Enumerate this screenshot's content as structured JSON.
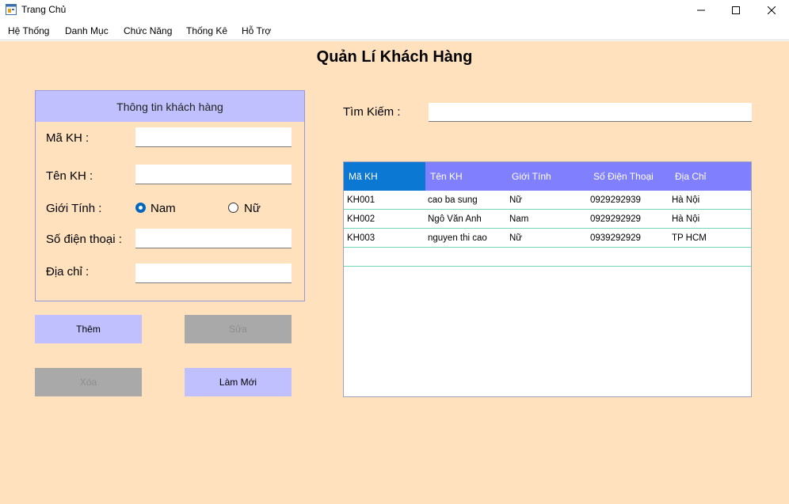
{
  "window": {
    "title": "Trang Chủ",
    "icon": "app-form-icon"
  },
  "menu": {
    "items": [
      {
        "label": "Hệ Thống"
      },
      {
        "label": "Danh Mục"
      },
      {
        "label": "Chức Năng"
      },
      {
        "label": "Thống Kê"
      },
      {
        "label": "Hỗ Trợ"
      }
    ]
  },
  "page": {
    "title": "Quản Lí Khách Hàng"
  },
  "customer_form": {
    "header": "Thông tin khách hàng",
    "ma_kh_label": "Mã KH :",
    "ma_kh_value": "",
    "ten_kh_label": "Tên KH :",
    "ten_kh_value": "",
    "gioi_tinh_label": "Giới Tính :",
    "gender_options": [
      {
        "label": "Nam",
        "checked": true
      },
      {
        "label": "Nữ",
        "checked": false
      }
    ],
    "sdt_label": "Số điện thoại :",
    "sdt_value": "",
    "dia_chi_label": "Địa chỉ :",
    "dia_chi_value": ""
  },
  "actions": {
    "them": {
      "label": "Thêm",
      "enabled": true
    },
    "sua": {
      "label": "Sửa",
      "enabled": false
    },
    "xoa": {
      "label": "Xóa",
      "enabled": false
    },
    "lam_moi": {
      "label": "Làm Mới",
      "enabled": true
    }
  },
  "search": {
    "label": "Tìm Kiếm :",
    "value": ""
  },
  "grid": {
    "columns": [
      "Mã KH",
      "Tên KH",
      "Giới Tính",
      "Số Điện Thoại",
      "Địa Chỉ"
    ],
    "rows": [
      [
        "KH001",
        "cao ba sung",
        "Nữ",
        "0929292939",
        "Hà Nội"
      ],
      [
        "KH002",
        "Ngô Văn Anh",
        "Nam",
        "0929292929",
        "Hà Nội"
      ],
      [
        "KH003",
        "nguyen thi cao",
        "Nữ",
        "0939292929",
        "TP HCM"
      ]
    ]
  },
  "colors": {
    "background": "#ffe1be",
    "accent": "#c0c0ff",
    "grid_header": "#8080ff",
    "grid_header_selected": "#0b78d4",
    "disabled": "#a9a9a9"
  }
}
